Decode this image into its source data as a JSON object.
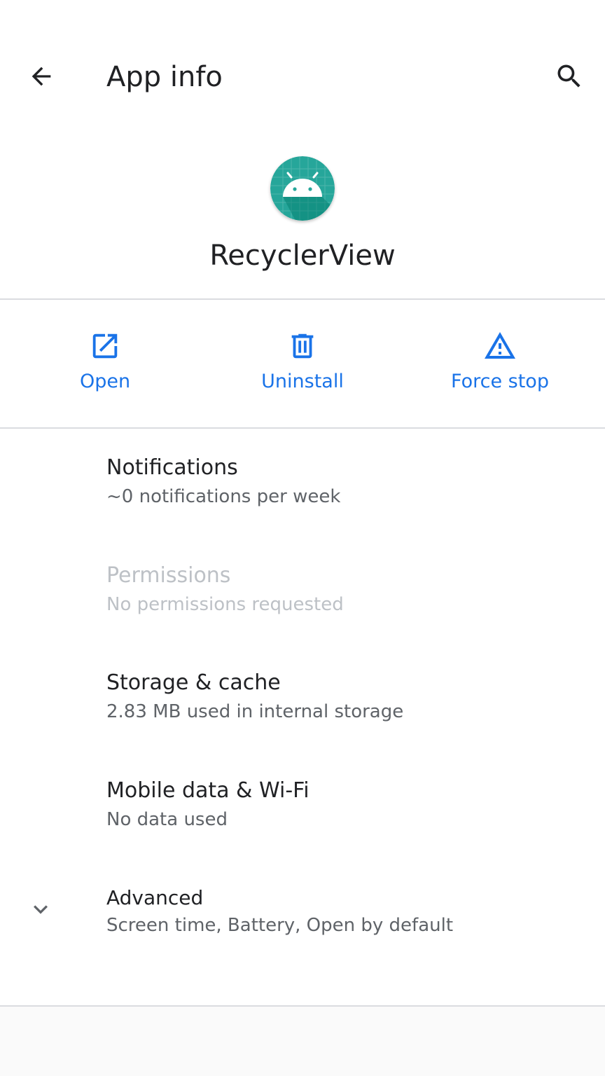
{
  "topbar": {
    "title": "App info",
    "back_icon": "arrow-back-icon",
    "search_icon": "search-icon"
  },
  "header": {
    "app_name": "RecyclerView",
    "app_icon": "android-app-icon"
  },
  "actions": [
    {
      "label": "Open",
      "icon": "open-external-icon"
    },
    {
      "label": "Uninstall",
      "icon": "trash-icon"
    },
    {
      "label": "Force stop",
      "icon": "warning-icon"
    }
  ],
  "settings": {
    "notifications": {
      "title": "Notifications",
      "summary": "~0 notifications per week"
    },
    "permissions": {
      "title": "Permissions",
      "summary": "No permissions requested"
    },
    "storage": {
      "title": "Storage & cache",
      "summary": "2.83 MB used in internal storage"
    },
    "mobile_data": {
      "title": "Mobile data & Wi-Fi",
      "summary": "No data used"
    },
    "advanced": {
      "title": "Advanced",
      "summary": "Screen time, Battery, Open by default",
      "icon": "chevron-down-icon"
    }
  },
  "colors": {
    "accent": "#1a73e8",
    "icon_bg": "#26a69a",
    "text_primary": "#202124",
    "text_secondary": "#5f6368",
    "text_disabled": "#bdc1c6"
  }
}
